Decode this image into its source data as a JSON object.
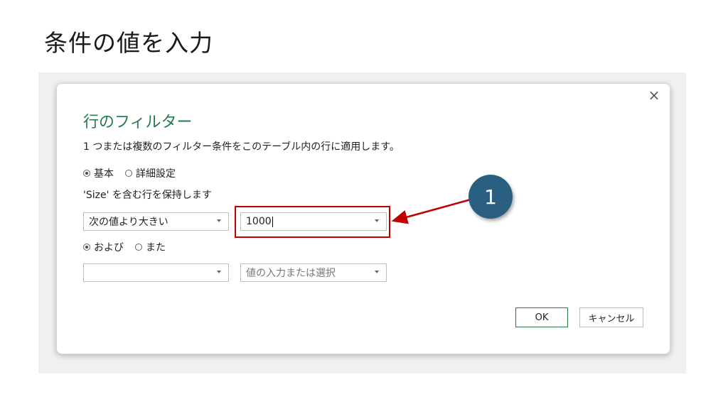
{
  "slide": {
    "title": "条件の値を入力"
  },
  "dialog": {
    "close_icon": "×",
    "title": "行のフィルター",
    "description": "1 つまたは複数のフィルター条件をこのテーブル内の行に適用します。",
    "mode_options": [
      {
        "label": "基本",
        "checked": true
      },
      {
        "label": "詳細設定",
        "checked": false
      }
    ],
    "keep_label": "'Size' を含む行を保持します",
    "condition1": {
      "operator": "次の値より大きい",
      "value": "1000"
    },
    "logic_options": [
      {
        "label": "および",
        "checked": true
      },
      {
        "label": "また",
        "checked": false
      }
    ],
    "condition2": {
      "operator": "",
      "value_placeholder": "値の入力または選択"
    },
    "ok_label": "OK",
    "cancel_label": "キャンセル"
  },
  "annotation": {
    "badge": "1",
    "color": "#c00000",
    "badge_color": "#2b5f82"
  }
}
